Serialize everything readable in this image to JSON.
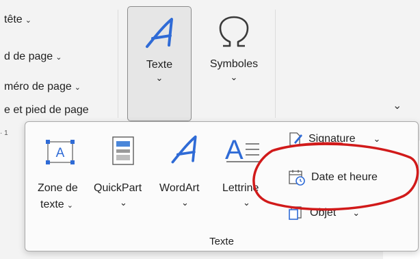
{
  "ribbon": {
    "partial_items": [
      {
        "label": "tête",
        "chevron": "⌄"
      },
      {
        "label": "d de page",
        "chevron": "⌄"
      },
      {
        "label": "méro de page",
        "chevron": "⌄"
      },
      {
        "label": "e et pied de page",
        "chevron": ""
      }
    ],
    "texte_button": {
      "label": "Texte",
      "icon": "wordart-a-icon",
      "chevron": "⌄"
    },
    "symboles_button": {
      "label": "Symboles",
      "icon": "omega-icon",
      "chevron": "⌄"
    },
    "collapse_chevron": "⌄",
    "ruler_text": "· 1"
  },
  "texte_gallery": {
    "group_label": "Texte",
    "tools": [
      {
        "line1": "Zone de",
        "line2": "texte",
        "chevron": "⌄",
        "icon": "text-box-icon"
      },
      {
        "line1": "QuickPart",
        "line2": "",
        "chevron": "⌄",
        "icon": "quickpart-icon"
      },
      {
        "line1": "WordArt",
        "line2": "",
        "chevron": "⌄",
        "icon": "wordart-icon"
      },
      {
        "line1": "Lettrine",
        "line2": "",
        "chevron": "⌄",
        "icon": "drop-cap-icon"
      }
    ],
    "small_items": [
      {
        "label": "Signature",
        "chevron": "⌄",
        "icon": "signature-line-icon"
      },
      {
        "label": "Date et heure",
        "chevron": "",
        "icon": "date-time-icon"
      },
      {
        "label": "Objet",
        "chevron": "⌄",
        "icon": "object-icon"
      }
    ]
  },
  "colors": {
    "accent_blue": "#2f6bd6",
    "annotation_red": "#d11a1a"
  }
}
